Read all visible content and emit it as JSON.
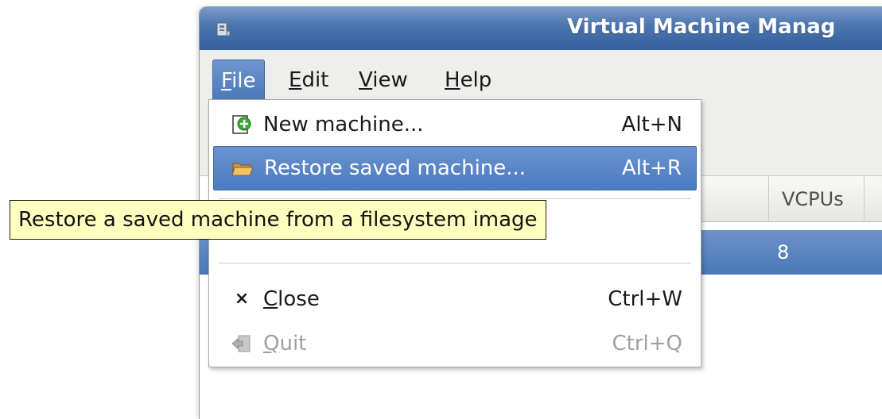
{
  "window": {
    "title": "Virtual Machine Manag"
  },
  "menubar": {
    "items": [
      {
        "label": "File",
        "mnemonic": "F",
        "rest": "ile",
        "active": true
      },
      {
        "label": "Edit",
        "mnemonic": "E",
        "rest": "dit",
        "active": false
      },
      {
        "label": "View",
        "mnemonic": "V",
        "rest": "iew",
        "active": false
      },
      {
        "label": "Help",
        "mnemonic": "H",
        "rest": "elp",
        "active": false
      }
    ]
  },
  "table": {
    "headers": [
      "e",
      "VCPUs"
    ],
    "selected_row": {
      "vcpus": "8"
    }
  },
  "file_menu": {
    "new_machine": {
      "label": "New machine...",
      "accel": "Alt+N",
      "icon": "new-vm-icon"
    },
    "restore_saved_machine": {
      "label": "Restore saved machine...",
      "accel": "Alt+R",
      "icon": "folder-open-icon"
    },
    "close": {
      "mnemonic": "C",
      "rest": "lose",
      "accel": "Ctrl+W",
      "icon": "close-icon"
    },
    "quit": {
      "mnemonic": "Q",
      "rest": "uit",
      "accel": "Ctrl+Q",
      "icon": "quit-icon",
      "disabled": true
    }
  },
  "tooltip": {
    "text": "Restore a saved machine from a filesystem image"
  },
  "colors": {
    "titlebar": "#4a74ad",
    "highlight": "#4b7bc1",
    "tooltip_bg": "#ffffbf"
  }
}
